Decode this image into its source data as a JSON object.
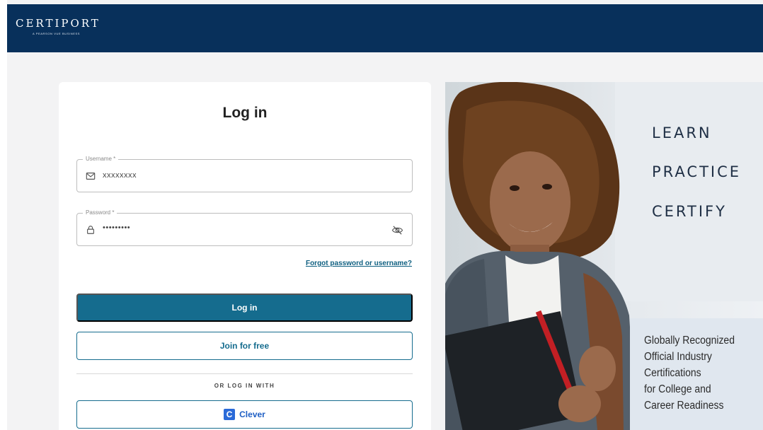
{
  "brand": {
    "logo_text": "CERTIPORT",
    "tagline": "A PEARSON VUE BUSINESS"
  },
  "login": {
    "title": "Log in",
    "username_label": "Username *",
    "username_value": "xxxxxxxx",
    "password_label": "Password *",
    "password_value": "•••••••••",
    "forgot_link": "Forgot password or username?",
    "login_button": "Log in",
    "join_button": "Join for free",
    "or_text": "OR LOG IN WITH",
    "clever_button": "Clever",
    "clever_icon_letter": "C"
  },
  "hero": {
    "lines": [
      "LEARN",
      "PRACTICE",
      "CERTIFY"
    ],
    "benefit": "Globally Recognized\nOfficial Industry\nCertifications\nfor College and\nCareer Readiness"
  },
  "colors": {
    "header": "#08305b",
    "primary": "#156c8e",
    "clever": "#2a6ad8",
    "page_bg": "#f3f3f4"
  },
  "icons": [
    "mail-icon",
    "lock-icon",
    "eye-off-icon",
    "clever-icon"
  ]
}
